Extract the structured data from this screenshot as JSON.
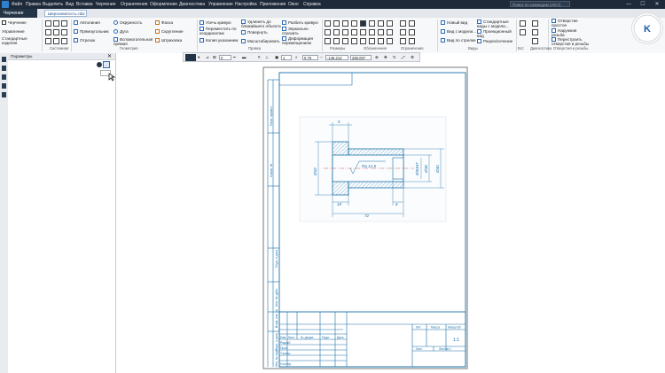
{
  "app": {
    "menu": [
      "Файл",
      "Правка",
      "Выделить",
      "Вид",
      "Вставка",
      "Черчение",
      "Ограничения",
      "Оформление",
      "Диагностика",
      "Управление",
      "Настройка",
      "Приложения",
      "Окно",
      "Справка"
    ],
    "search_placeholder": "Поиск по командам (Alt+/)",
    "window_controls": [
      "—",
      "☐",
      "✕"
    ]
  },
  "tabs": {
    "active_mode": "Черчение",
    "document": "Шероховатость.cdw"
  },
  "ribbon": {
    "left_col": [
      "Управление",
      "Стандартные изделия"
    ],
    "group_labels": [
      "Системная",
      "Геометрия",
      "Правка",
      "Размеры",
      "Обозначения",
      "Ограничения",
      "Виды",
      "Вст.",
      "Диагностика",
      "Отверстия и резьбы"
    ],
    "geometry": [
      "Автолиния",
      "Прямоугольник",
      "Отрезок",
      "Окружность",
      "Дуга",
      "Вспомогательная прямая",
      "Фаска",
      "Скругление",
      "Штриховка"
    ],
    "edit": [
      "Усечь кривую",
      "Переместить по координатам",
      "Копия указанием",
      "Удлинить до ближайшего объекта",
      "Повернуть",
      "Масштабировать",
      "Разбить кривую",
      "Зеркально отразить",
      "Деформация перемещением"
    ],
    "views": [
      "Новый вид",
      "Вид с модели...",
      "Вид по стрелке",
      "Стандартные виды с модели...",
      "Проекционный вид",
      "Разрез/сечение"
    ],
    "holes": [
      "Отверстие простое",
      "Наружная резьба",
      "Перестроить отверстия и резьбы"
    ]
  },
  "panel": {
    "title": "Параметры"
  },
  "viewbar": {
    "layer": "0",
    "view_no": "1",
    "zoom": "0.75",
    "coords": "-145.212",
    "coords2": "285.007"
  },
  "drawing": {
    "dims": {
      "top": "5",
      "d1": "Ø32",
      "d2": "Ø30H7",
      "d3": "Ø38",
      "d4": "Ø40",
      "len1": "10",
      "len2": "72",
      "len3": "6"
    },
    "roughness": "Ra 12,5",
    "side_labels": [
      "Перв. примен.",
      "Справ. №",
      "Подп. и дата",
      "Инв. № дубл.",
      "Взам. инв. №",
      "Подп. и дата",
      "Инв. № подл."
    ],
    "titleblock": {
      "headers": [
        "Изм",
        "Лист",
        "№ докум.",
        "Подп.",
        "Дата"
      ],
      "rows": [
        "Разраб.",
        "Пров.",
        "Т.контр.",
        "",
        "Н.контр.",
        "Утв."
      ],
      "lit_mass": [
        "Лит.",
        "Масса",
        "Масштаб"
      ],
      "scale": "1:1",
      "sheet": "Лист",
      "sheets": "Листов 1"
    }
  },
  "brand": {
    "accent": "#2f7fd1",
    "ribbon_dark": "#243447",
    "drawing_line": "#1a6fa8"
  }
}
